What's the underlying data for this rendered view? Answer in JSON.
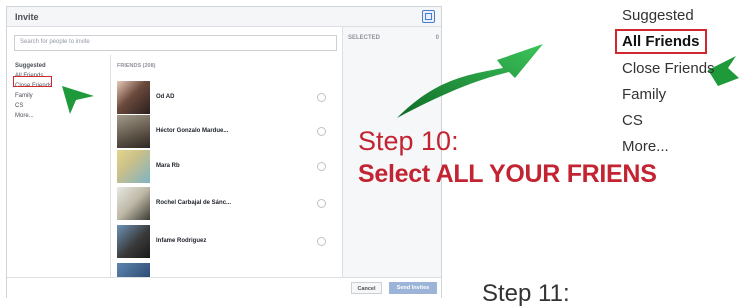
{
  "dialog": {
    "title": "Invite",
    "search_placeholder": "Search for people to invite",
    "selected_label": "SELECTED",
    "selected_count": "0",
    "friends_header": "FRIENDS (208)",
    "categories": [
      {
        "label": "Suggested",
        "selected": false
      },
      {
        "label": "All Friends",
        "selected": true
      },
      {
        "label": "Close Friends",
        "selected": false
      },
      {
        "label": "Family",
        "selected": false
      },
      {
        "label": "CS",
        "selected": false
      },
      {
        "label": "More...",
        "selected": false
      }
    ],
    "friends": [
      {
        "name": "Od AD"
      },
      {
        "name": "Héctor Gonzalo Mardue..."
      },
      {
        "name": "Mara Rb"
      },
      {
        "name": "Rochel Carbajal de Sánc..."
      },
      {
        "name": "Infame Rodriguez"
      }
    ],
    "cancel_label": "Cancel",
    "send_label": "Send Invites"
  },
  "annotation": {
    "step10_title": "Step 10:",
    "step10_text": "Select ALL YOUR FRIENS",
    "step11_title": "Step 11:",
    "zoom_items": [
      {
        "label": "Suggested",
        "selected": false
      },
      {
        "label": "All Friends",
        "selected": true
      },
      {
        "label": "Close Friends",
        "selected": false
      },
      {
        "label": "Family",
        "selected": false
      },
      {
        "label": "CS",
        "selected": false
      },
      {
        "label": "More...",
        "selected": false
      }
    ]
  },
  "colors": {
    "accent_red": "#c22432",
    "highlight_box": "#d0282e",
    "arrow_green": "#1f9a3a",
    "send_button": "#9cb4d8"
  }
}
